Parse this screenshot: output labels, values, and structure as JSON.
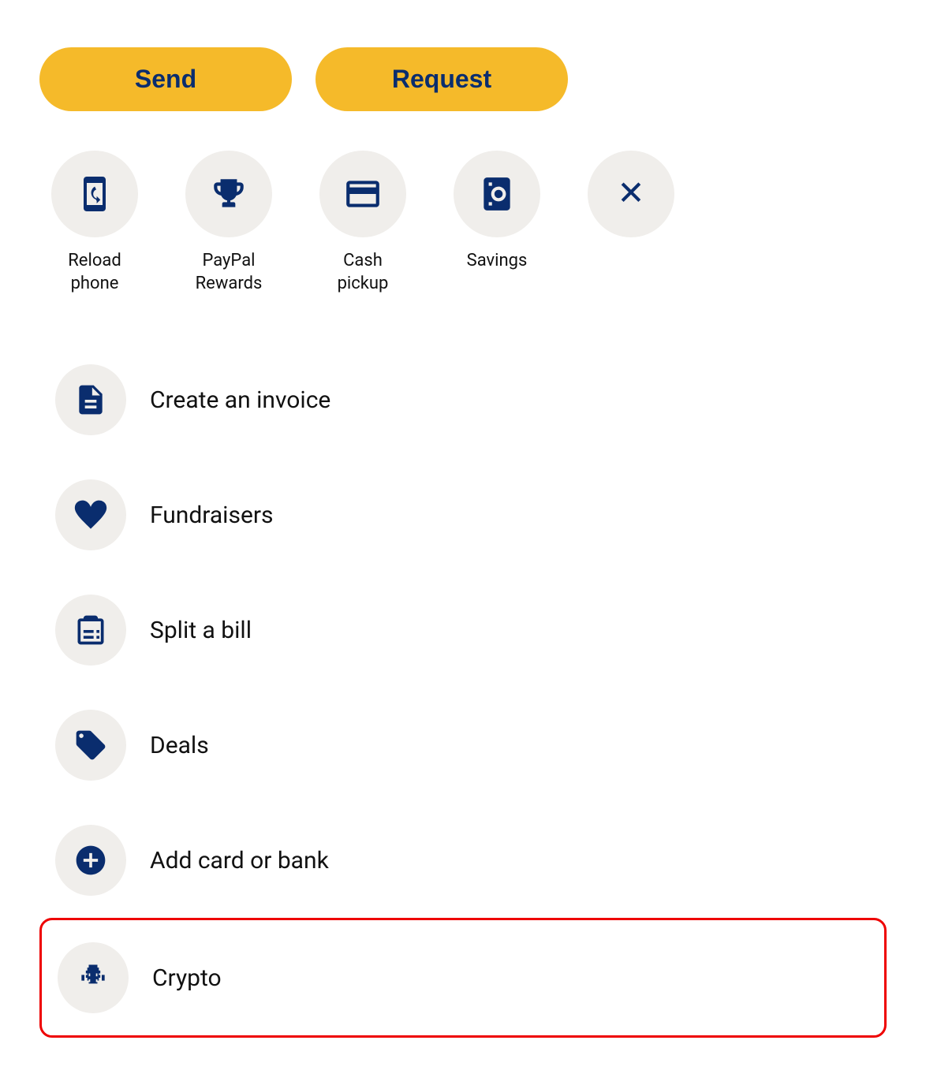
{
  "buttons": {
    "send": "Send",
    "request": "Request"
  },
  "quickActions": [
    {
      "id": "reload-phone",
      "label": "Reload\nphone",
      "icon": "phone-reload"
    },
    {
      "id": "paypal-rewards",
      "label": "PayPal\nRewards",
      "icon": "trophy"
    },
    {
      "id": "cash-pickup",
      "label": "Cash\npickup",
      "icon": "cash"
    },
    {
      "id": "savings",
      "label": "Savings",
      "icon": "safe"
    },
    {
      "id": "close",
      "label": "",
      "icon": "close"
    }
  ],
  "listItems": [
    {
      "id": "create-invoice",
      "label": "Create an invoice",
      "icon": "invoice"
    },
    {
      "id": "fundraisers",
      "label": "Fundraisers",
      "icon": "fundraiser"
    },
    {
      "id": "split-bill",
      "label": "Split a bill",
      "icon": "split-bill"
    },
    {
      "id": "deals",
      "label": "Deals",
      "icon": "deals"
    },
    {
      "id": "add-card-bank",
      "label": "Add card or bank",
      "icon": "add-bank"
    },
    {
      "id": "crypto",
      "label": "Crypto",
      "icon": "crypto",
      "highlighted": true
    }
  ]
}
